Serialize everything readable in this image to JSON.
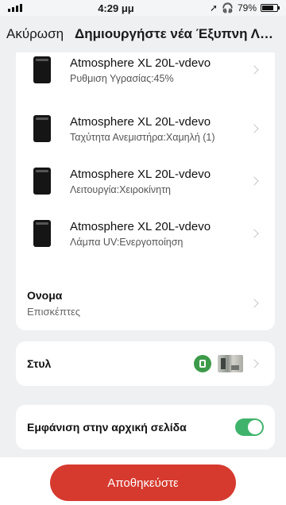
{
  "status_bar": {
    "time": "4:29 μμ",
    "battery": "79%",
    "battery_level": 0.79
  },
  "header": {
    "cancel_label": "Ακύρωση",
    "title": "Δημιουργήστε νέα Έξυπνη Λει..."
  },
  "devices": [
    {
      "name": "Atmosphere XL 20L-vdevo",
      "desc": "Ρυθμιση Υγρασίας:45%"
    },
    {
      "name": "Atmosphere XL 20L-vdevo",
      "desc": "Ταχύτητα Ανεμιστήρα:Χαμηλή (1)"
    },
    {
      "name": "Atmosphere XL 20L-vdevo",
      "desc": "Λειτουργία:Χειροκίνητη"
    },
    {
      "name": "Atmosphere XL 20L-vdevo",
      "desc": "Λάμπα UV:Ενεργοποίηση"
    }
  ],
  "name_row": {
    "label": "Ονομα",
    "value": "Επισκέπτες"
  },
  "style_row": {
    "label": "Στυλ",
    "accent": "#3d9a4a"
  },
  "home_row": {
    "label": "Εμφάνιση στην αρχική σελίδα",
    "enabled": true,
    "toggle_color": "#3fb36b"
  },
  "footer": {
    "save_label": "Αποθηκεύστε",
    "button_color": "#d63a2f"
  }
}
